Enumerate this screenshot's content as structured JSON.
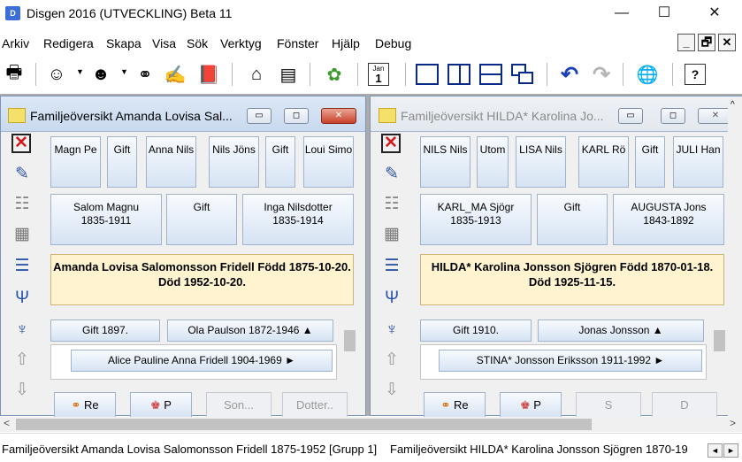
{
  "app": {
    "title": "Disgen 2016 (UTVECKLING) Beta 11",
    "icon_label": "D"
  },
  "window_controls": {
    "minimize": "—",
    "maximize": "☐",
    "close": "✕"
  },
  "menu": [
    "Arkiv",
    "Redigera",
    "Skapa",
    "Visa",
    "Sök",
    "Verktyg",
    "Fönster",
    "Hjälp",
    "Debug"
  ],
  "mdi_controls": {
    "minimize": "_",
    "restore": "🗗",
    "close": "✕"
  },
  "toolbar": {
    "calendar_top": "Jan",
    "calendar_day": "1",
    "help_label": "?"
  },
  "windows": [
    {
      "title": "Familjeöversikt Amanda Lovisa Sal...",
      "grandparents": [
        "Magn Pe",
        "Gift",
        "Anna Nils",
        "Nils Jöns",
        "Gift",
        "Loui Simo"
      ],
      "father": {
        "name": "Salom Magnu",
        "years": "1835-1911"
      },
      "marriage_label": "Gift",
      "mother": {
        "name": "Inga Nilsdotter",
        "years": "1835-1914"
      },
      "main_line1": "Amanda Lovisa Salomonsson Fridell",
      "main_line2": "Född 1875-10-20. Död 1952-10-20.",
      "spouse_marriage": "Gift 1897.",
      "spouse": "Ola Paulson 1872-1946 ▲",
      "children": [
        "Alice Pauline Anna Fridell 1904-1969 ►"
      ],
      "buttons": [
        "Re",
        "P",
        "Son...",
        "Dotter.."
      ]
    },
    {
      "title": "Familjeöversikt HILDA* Karolina Jo...",
      "grandparents": [
        "NILS Nils",
        "Utom",
        "LISA Nils",
        "KARL Rö",
        "Gift",
        "JULI Han"
      ],
      "father": {
        "name": "KARL_MA Sjögr",
        "years": "1835-1913"
      },
      "marriage_label": "Gift",
      "mother": {
        "name": "AUGUSTA Jons",
        "years": "1843-1892"
      },
      "main_line1": "HILDA* Karolina Jonsson Sjögren",
      "main_line2": "Född 1870-01-18. Död 1925-11-15.",
      "spouse_marriage": "Gift 1910.",
      "spouse": "Jonas Jonsson ▲",
      "children": [
        "STINA* Jonsson Eriksson 1911-1992 ►"
      ],
      "buttons": [
        "Re",
        "P",
        "S",
        "D"
      ]
    }
  ],
  "tabs": [
    "Familjeöversikt Amanda Lovisa Salomonsson Fridell 1875-1952 [Grupp 1]",
    "Familjeöversikt HILDA* Karolina Jonsson Sjögren 1870-19"
  ],
  "scroll_arrows": {
    "left": "<",
    "right": ">",
    "up": "^",
    "down": "v",
    "tab_left": "◄",
    "tab_right": "►"
  }
}
